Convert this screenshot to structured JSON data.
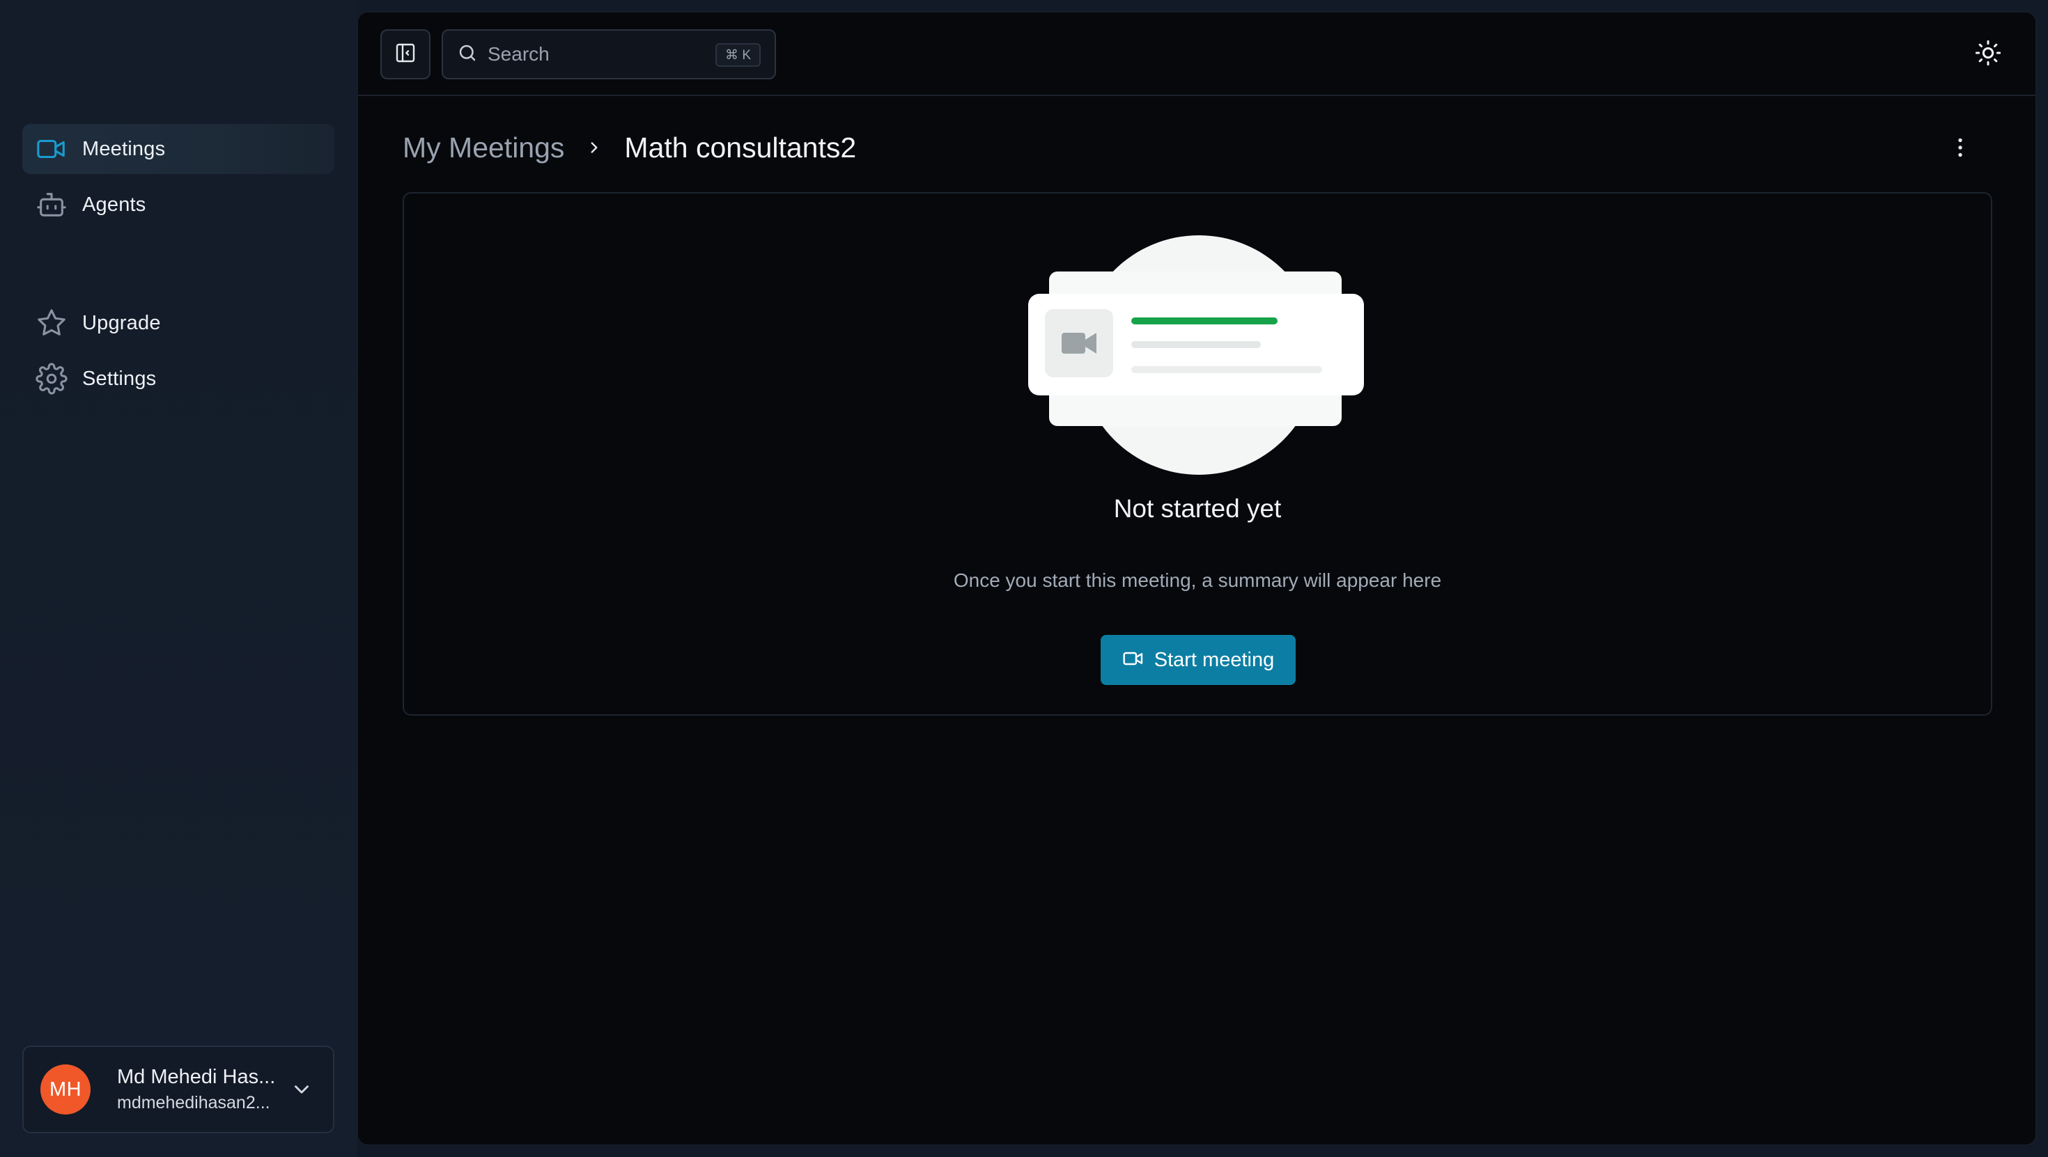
{
  "sidebar": {
    "items": [
      {
        "label": "Meetings",
        "icon": "video-icon",
        "active": true
      },
      {
        "label": "Agents",
        "icon": "bot-icon",
        "active": false
      },
      {
        "label": "Upgrade",
        "icon": "star-icon",
        "active": false
      },
      {
        "label": "Settings",
        "icon": "gear-icon",
        "active": false
      }
    ],
    "user": {
      "initials": "MH",
      "name": "Md Mehedi Has...",
      "email": "mdmehedihasan2..."
    }
  },
  "topbar": {
    "search_placeholder": "Search",
    "search_shortcut": "⌘ K"
  },
  "breadcrumb": {
    "parent": "My Meetings",
    "current": "Math consultants2"
  },
  "empty_state": {
    "title": "Not started yet",
    "subtitle": "Once you start this meeting, a summary will appear here",
    "button_label": "Start meeting"
  },
  "colors": {
    "accent": "#0d7ea3",
    "active_icon": "#1a9ccf",
    "avatar": "#f0582a",
    "progress_green": "#16a34a"
  }
}
